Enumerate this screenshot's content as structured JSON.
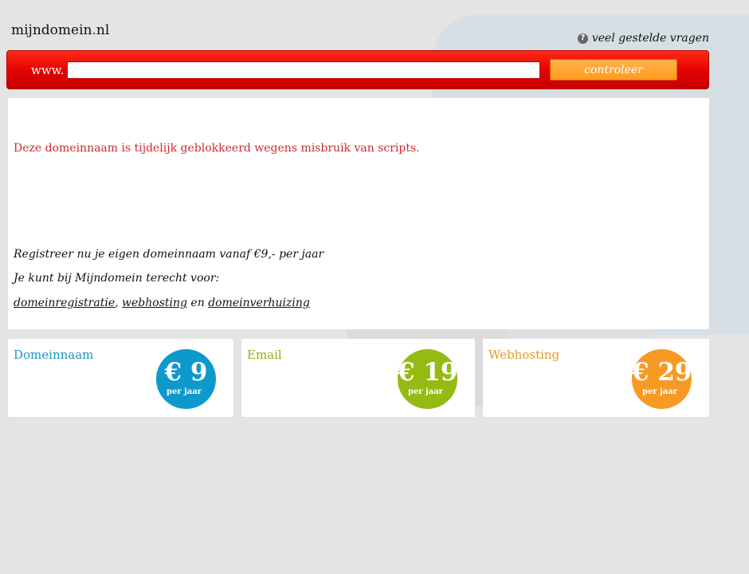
{
  "header": {
    "logo_name": "mijndomein",
    "logo_dot": ".",
    "logo_tld": "nl",
    "faq_label": "veel gestelde vragen",
    "faq_icon": "question-circle-icon"
  },
  "search": {
    "prefix": "www.",
    "input_value": "",
    "button_label": "controleer"
  },
  "main": {
    "blocked_message": "Deze domeinnaam is tijdelijk geblokkeerd wegens misbruik van scripts.",
    "promo_line1": "Registreer nu je eigen domeinnaam vanaf €9,- per jaar",
    "promo_line2": "Je kunt bij Mijndomein terecht voor:",
    "links": {
      "registration": "domeinregistratie",
      "comma": ",",
      "hosting": "webhosting",
      "and": "en",
      "transfer": "domeinverhuizing"
    }
  },
  "cards": [
    {
      "title": "Domeinnaam",
      "price": "€ 9",
      "unit": "per jaar",
      "color": "#1a96c8",
      "badge_color": "#0e99cc"
    },
    {
      "title": "Email",
      "price": "€ 19",
      "unit": "per jaar",
      "color": "#8fad1a",
      "badge_color": "#95ba14"
    },
    {
      "title": "Webhosting",
      "price": "€ 29",
      "unit": "per jaar",
      "color": "#e8982a",
      "badge_color": "#f79a25"
    }
  ]
}
